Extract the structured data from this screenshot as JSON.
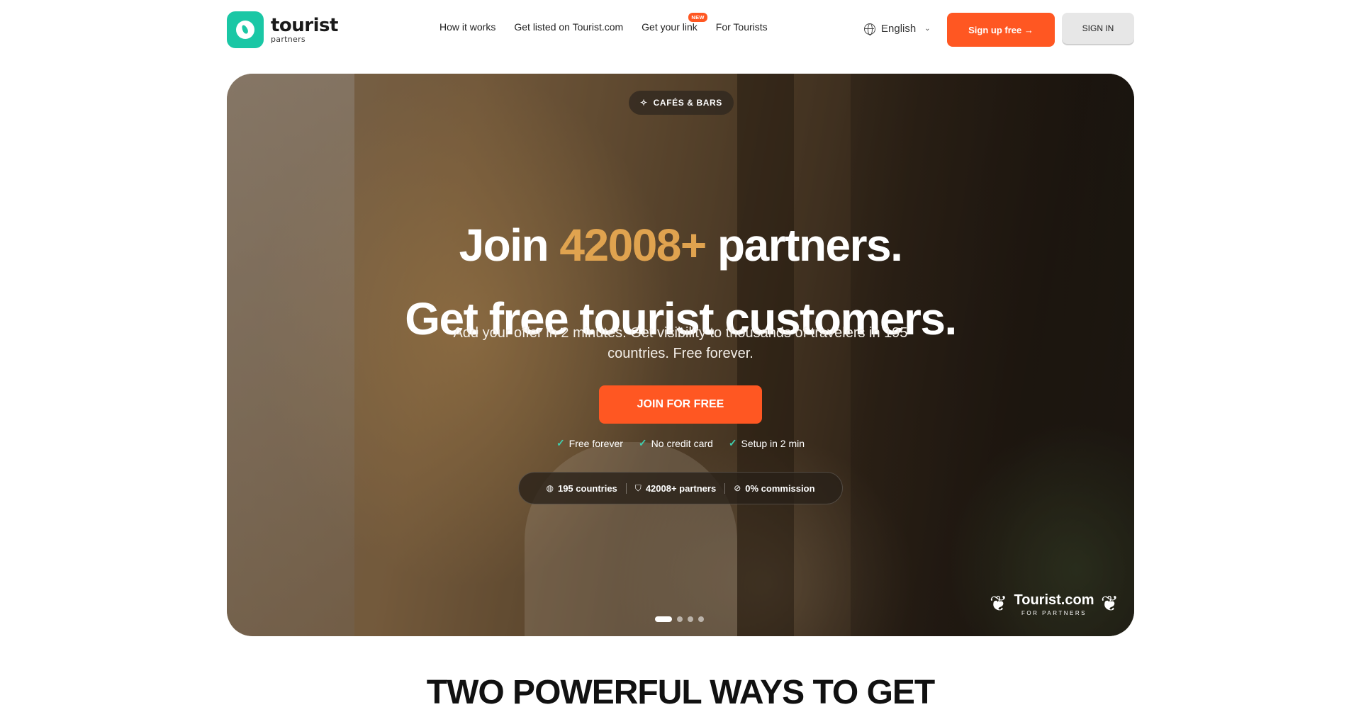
{
  "header": {
    "logo": {
      "word": "tourist",
      "sub": "partners"
    },
    "nav": [
      {
        "label": "How it works"
      },
      {
        "label": "Get listed on Tourist.com"
      },
      {
        "label": "Get your link",
        "badge": "NEW"
      },
      {
        "label": "For Tourists"
      }
    ],
    "language": "English",
    "signup_label": "Sign up free →",
    "signin_label": "SIGN IN"
  },
  "hero": {
    "tag": "CAFÉS & BARS",
    "title_pre": "Join ",
    "title_accent": "42008+",
    "title_post": " partners.",
    "title_line2": "Get free tourist customers.",
    "subtitle_line1": "Add your offer in 2 minutes. Get visibility to thousands of travelers in 195",
    "subtitle_line2": "countries. Free forever.",
    "cta_label": "JOIN FOR FREE",
    "checks": [
      "Free forever",
      "No credit card",
      "Setup in 2 min"
    ],
    "stats": [
      {
        "icon": "globe-icon",
        "label": "195 countries"
      },
      {
        "icon": "shield-icon",
        "label": "42008+ partners"
      },
      {
        "icon": "percent-icon",
        "label": "0% commission"
      }
    ],
    "carousel": {
      "total": 4,
      "active": 1
    },
    "award": {
      "title": "Tourist.com",
      "subtitle": "FOR PARTNERS"
    }
  },
  "section": {
    "title": "TWO POWERFUL WAYS TO GET"
  },
  "colors": {
    "brand_teal": "#1ac7a5",
    "accent_orange": "#ff5722",
    "highlight_gold": "#e0a34f"
  }
}
